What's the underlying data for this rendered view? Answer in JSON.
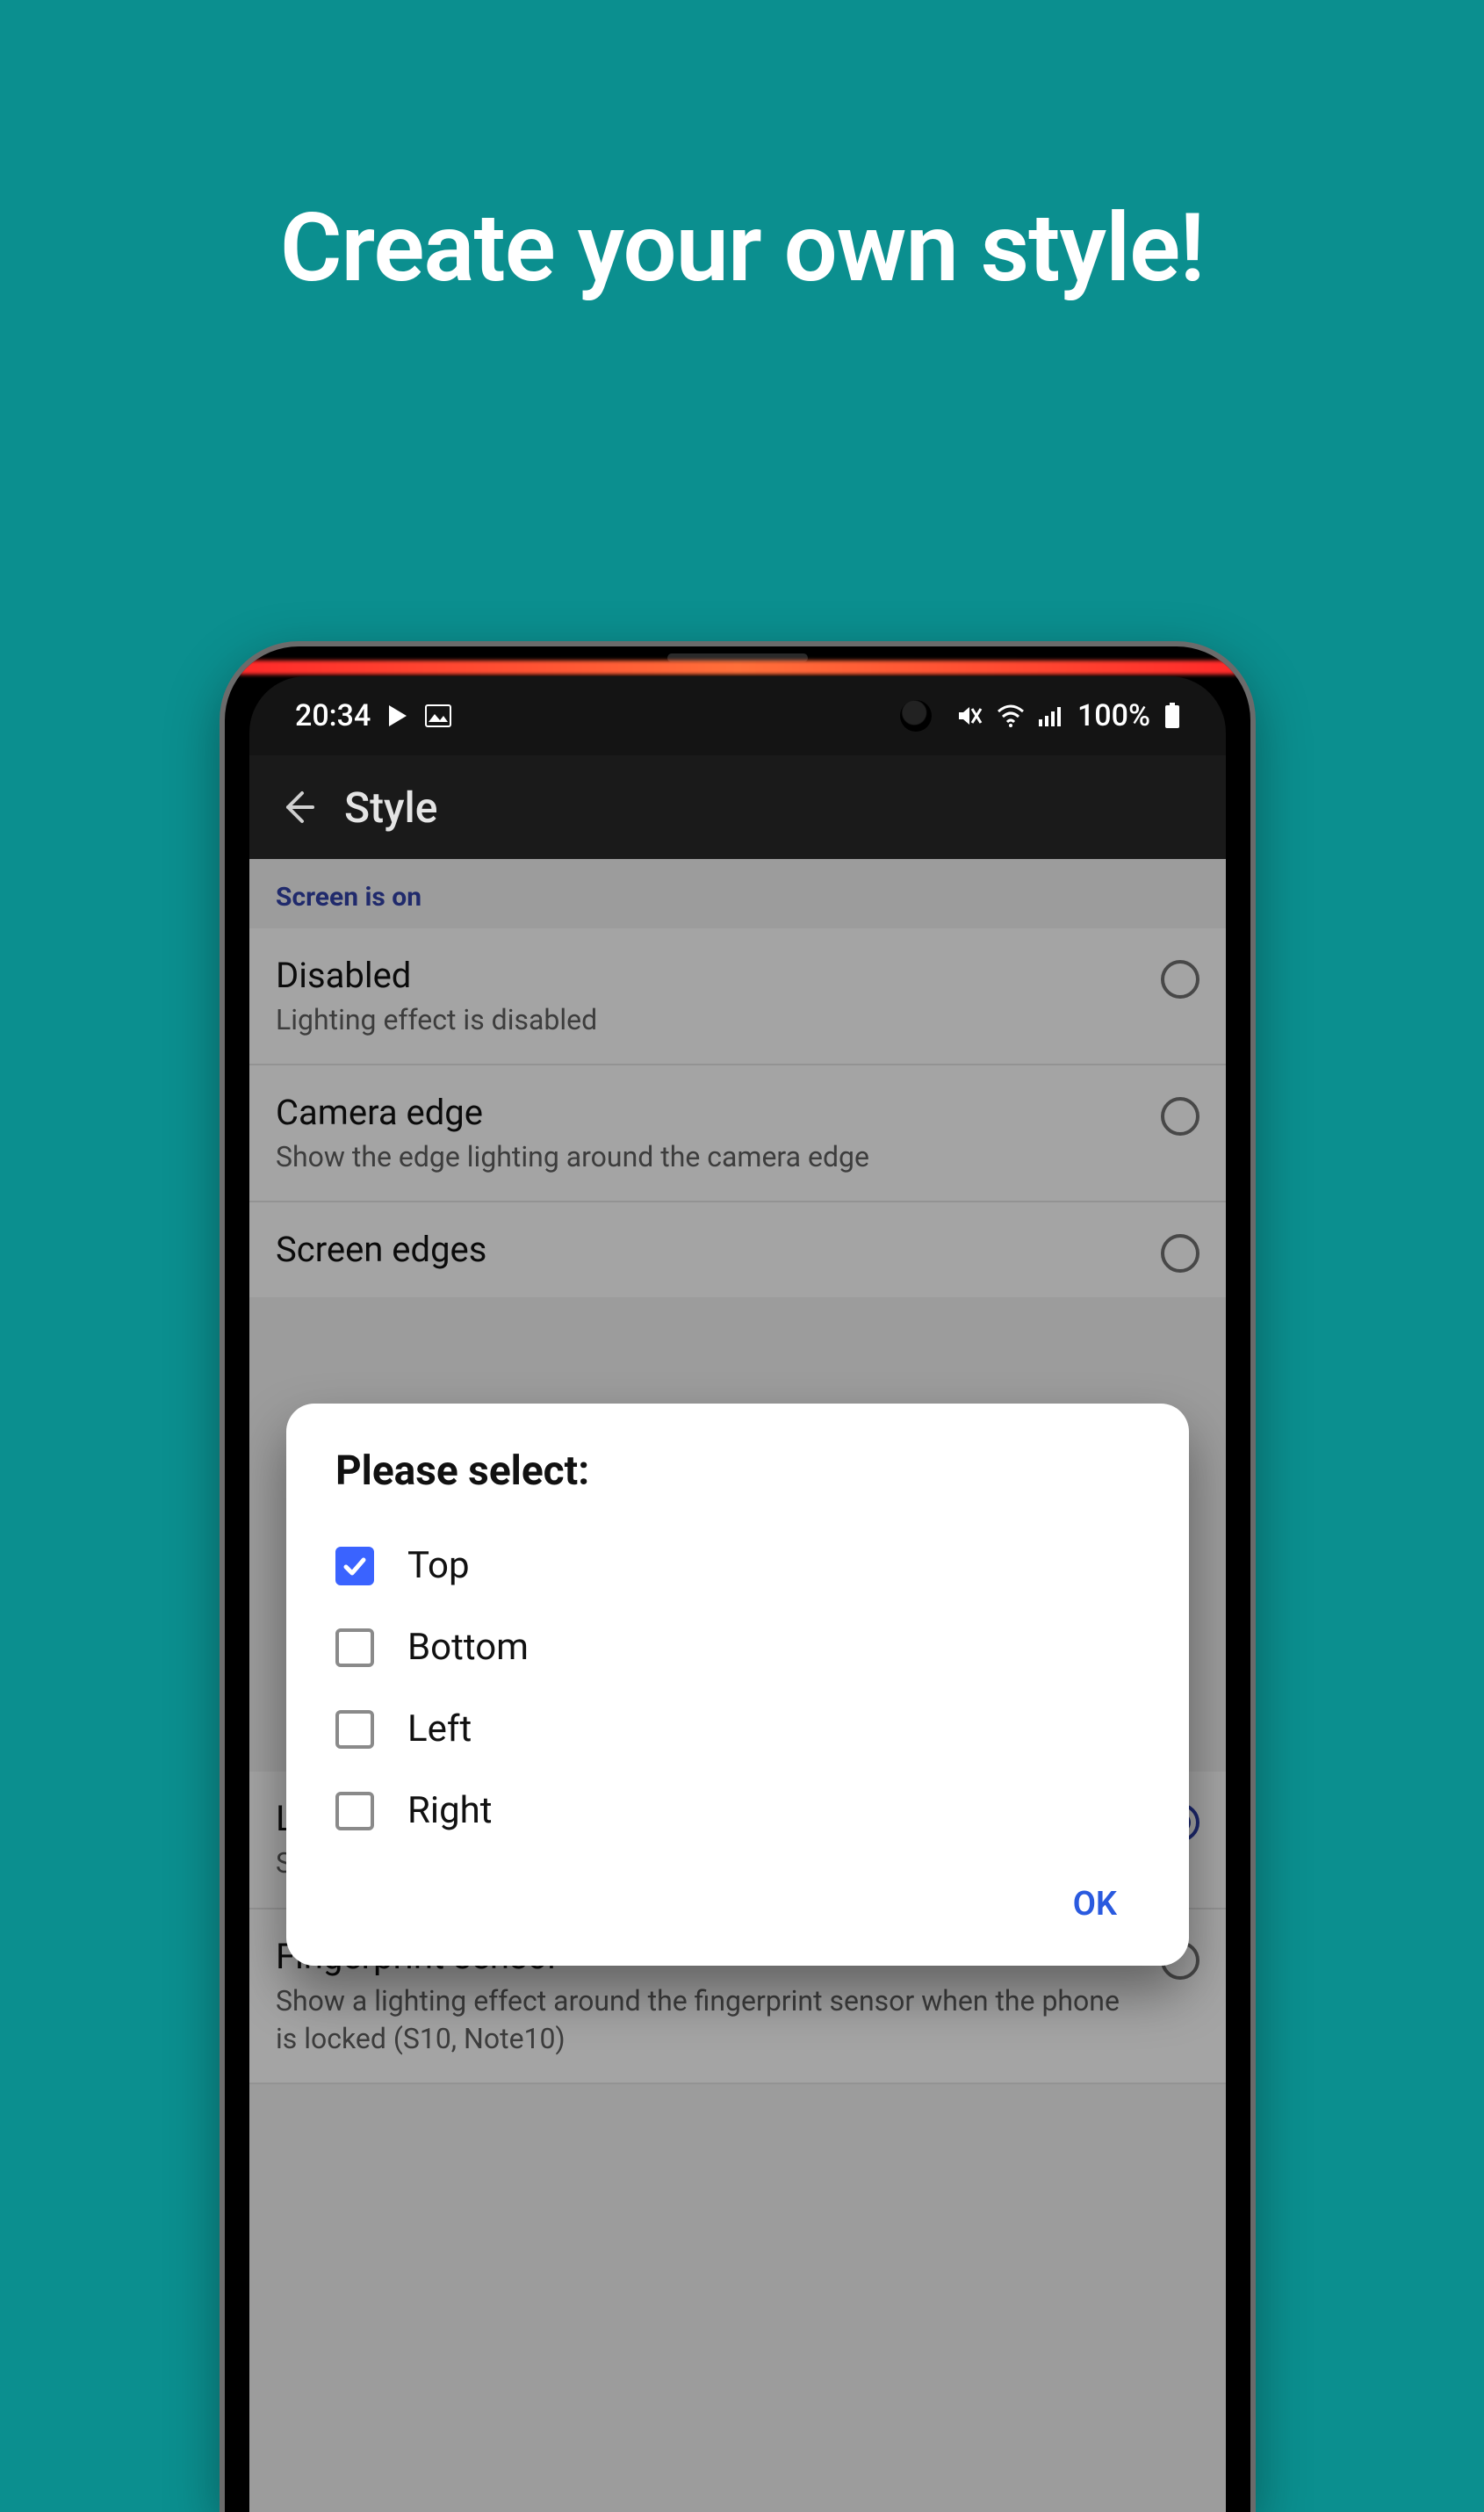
{
  "headline": "Create your own style!",
  "statusbar": {
    "time": "20:34",
    "battery_text": "100%",
    "icons": [
      "play-icon",
      "picture-icon",
      "mute-vibrate-icon",
      "wifi-icon",
      "signal-icon",
      "battery-icon"
    ]
  },
  "appbar": {
    "title": "Style"
  },
  "section_header": "Screen is on",
  "rows": [
    {
      "title": "Disabled",
      "sub": "Lighting effect is disabled",
      "selected": false
    },
    {
      "title": "Camera edge",
      "sub": "Show the edge lighting around the camera edge",
      "selected": false
    },
    {
      "title": "Screen edges",
      "sub": "",
      "selected": false
    },
    {
      "title": "LED Dot",
      "sub": "Show a \"LED\" dot in the statusbar",
      "selected": true
    },
    {
      "title": "Fingerprint sensor",
      "sub": "Show a lighting effect around the fingerprint sensor when the phone is locked (S10, Note10)",
      "selected": false
    }
  ],
  "dialog": {
    "title": "Please select:",
    "options": [
      {
        "label": "Top",
        "checked": true
      },
      {
        "label": "Bottom",
        "checked": false
      },
      {
        "label": "Left",
        "checked": false
      },
      {
        "label": "Right",
        "checked": false
      }
    ],
    "ok_label": "OK"
  }
}
